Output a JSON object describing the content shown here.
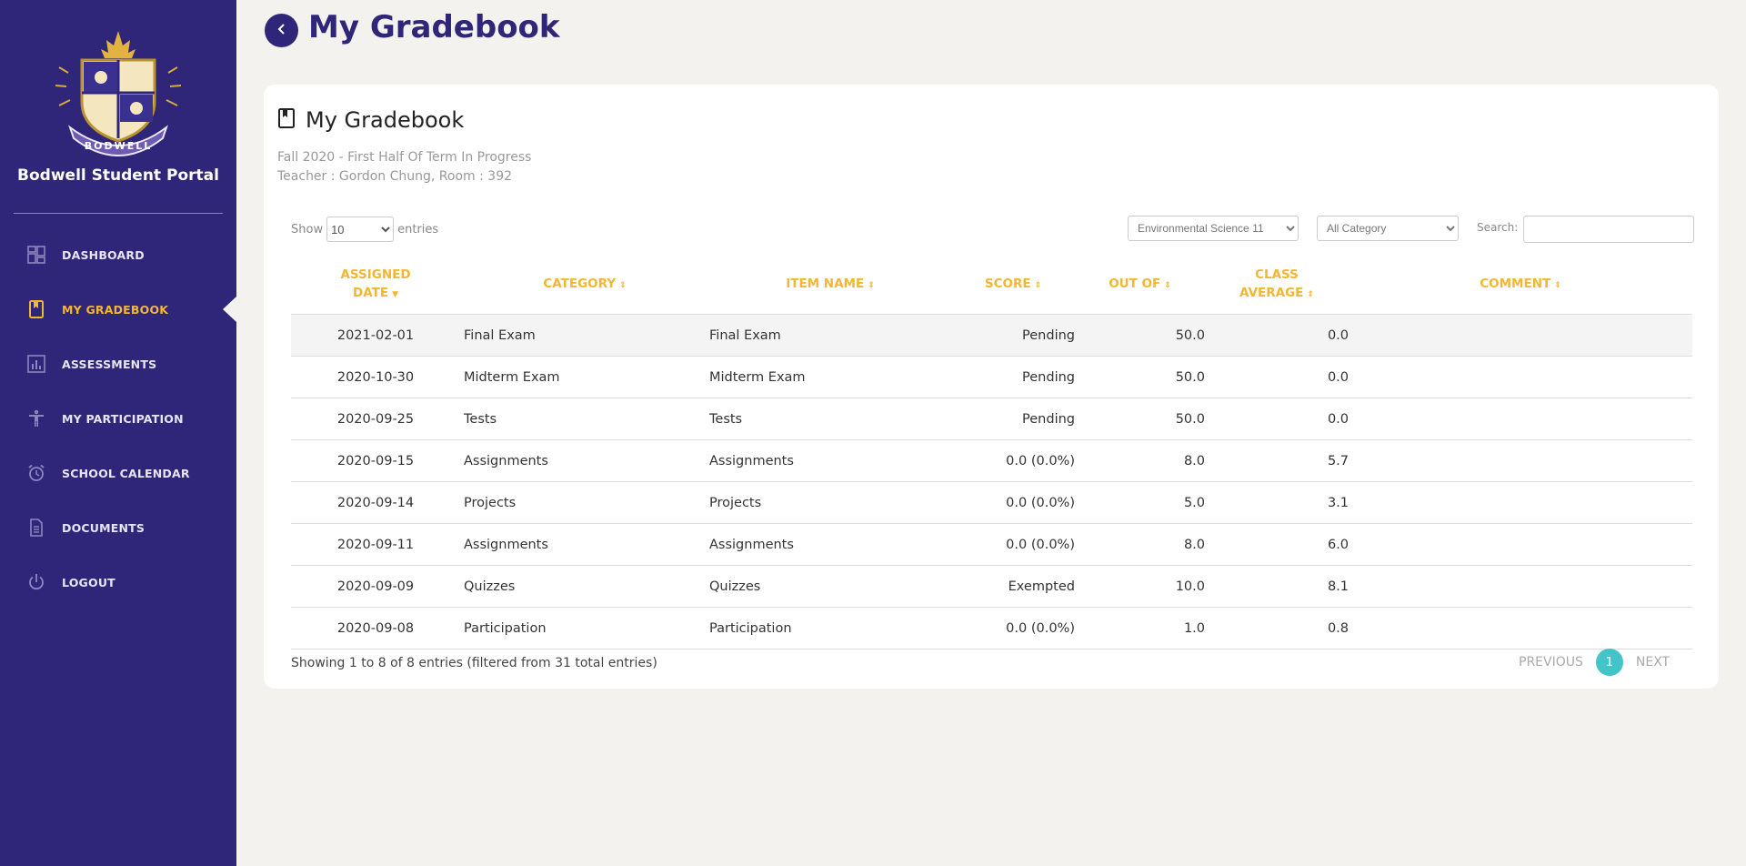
{
  "sidebar": {
    "portal_name": "Bodwell Student Portal",
    "logo_text": "BODWELL",
    "items": [
      {
        "label": "DASHBOARD",
        "icon": "dashboard-icon"
      },
      {
        "label": "MY GRADEBOOK",
        "icon": "gradebook-icon",
        "active": true
      },
      {
        "label": "ASSESSMENTS",
        "icon": "chart-icon"
      },
      {
        "label": "MY PARTICIPATION",
        "icon": "person-icon"
      },
      {
        "label": "SCHOOL CALENDAR",
        "icon": "alarm-clock-icon"
      },
      {
        "label": "DOCUMENTS",
        "icon": "document-icon"
      },
      {
        "label": "LOGOUT",
        "icon": "power-icon"
      }
    ],
    "colors": {
      "bg": "#2f2579",
      "active": "#f2b731"
    }
  },
  "header": {
    "title": "My Gradebook"
  },
  "card": {
    "title": "My Gradebook",
    "term": "Fall 2020 - First Half Of Term In Progress",
    "teacher": "Teacher : Gordon Chung, Room : 392"
  },
  "controls": {
    "show_label": "Show",
    "entries_label": "entries",
    "page_size": "10",
    "course": "Environmental Science 11",
    "category": "All Category",
    "search_label": "Search:",
    "search_value": ""
  },
  "table": {
    "headers": [
      {
        "line1": "ASSIGNED",
        "line2": "DATE"
      },
      {
        "line1": "CATEGORY"
      },
      {
        "line1": "ITEM NAME"
      },
      {
        "line1": "SCORE"
      },
      {
        "line1": "OUT OF"
      },
      {
        "line1": "CLASS",
        "line2": "AVERAGE"
      },
      {
        "line1": "COMMENT"
      }
    ],
    "rows": [
      {
        "date": "2021-02-01",
        "category": "Final Exam",
        "item": "Final Exam",
        "score": "Pending",
        "out_of": "50.0",
        "avg": "0.0",
        "comment": ""
      },
      {
        "date": "2020-10-30",
        "category": "Midterm Exam",
        "item": "Midterm Exam",
        "score": "Pending",
        "out_of": "50.0",
        "avg": "0.0",
        "comment": ""
      },
      {
        "date": "2020-09-25",
        "category": "Tests",
        "item": "Tests",
        "score": "Pending",
        "out_of": "50.0",
        "avg": "0.0",
        "comment": ""
      },
      {
        "date": "2020-09-15",
        "category": "Assignments",
        "item": "Assignments",
        "score": "0.0 (0.0%)",
        "out_of": "8.0",
        "avg": "5.7",
        "comment": ""
      },
      {
        "date": "2020-09-14",
        "category": "Projects",
        "item": "Projects",
        "score": "0.0 (0.0%)",
        "out_of": "5.0",
        "avg": "3.1",
        "comment": ""
      },
      {
        "date": "2020-09-11",
        "category": "Assignments",
        "item": "Assignments",
        "score": "0.0 (0.0%)",
        "out_of": "8.0",
        "avg": "6.0",
        "comment": ""
      },
      {
        "date": "2020-09-09",
        "category": "Quizzes",
        "item": "Quizzes",
        "score": "Exempted",
        "out_of": "10.0",
        "avg": "8.1",
        "comment": ""
      },
      {
        "date": "2020-09-08",
        "category": "Participation",
        "item": "Participation",
        "score": "0.0 (0.0%)",
        "out_of": "1.0",
        "avg": "0.8",
        "comment": ""
      }
    ]
  },
  "footer": {
    "info": "Showing 1 to 8 of 8 entries (filtered from 31 total entries)",
    "previous": "PREVIOUS",
    "page": "1",
    "next": "NEXT"
  }
}
